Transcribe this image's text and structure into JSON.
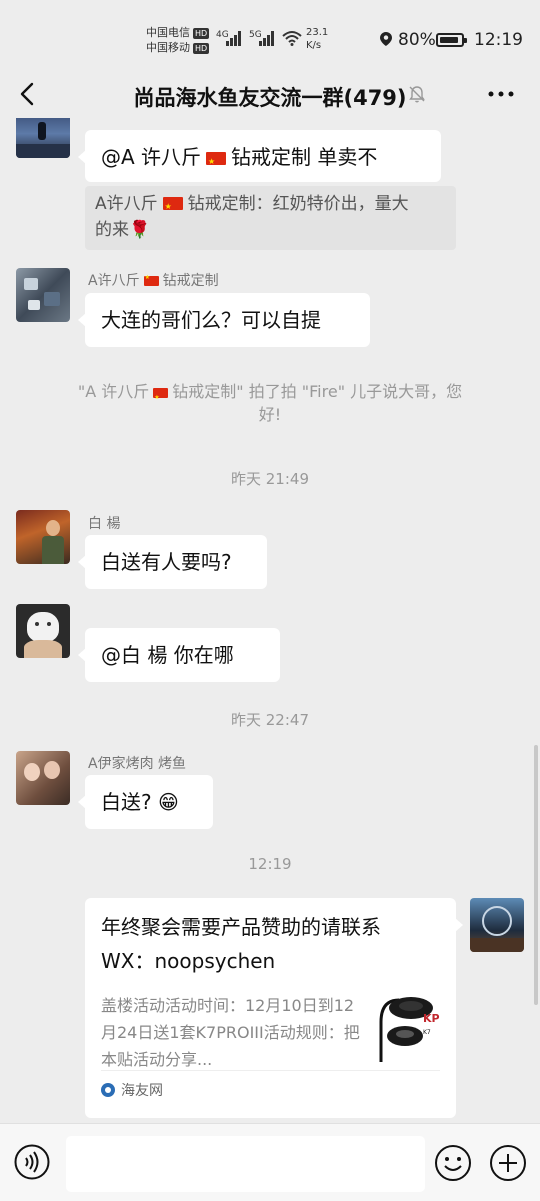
{
  "status_bar": {
    "carrier1": "中国电信",
    "carrier2": "中国移动",
    "hd": "HD",
    "net1": "4G",
    "net2": "5G",
    "speed_value": "23.1",
    "speed_unit": "K/s",
    "battery": "80%",
    "time": "12:19"
  },
  "header": {
    "title": "尚品海水鱼友交流一群(479)",
    "back_icon": "chevron-left-icon",
    "mute_icon": "bell-off-icon",
    "more_icon": "more-icon"
  },
  "messages": {
    "m1_text_a": "@A 许八斤",
    "m1_text_b": "钻戒定制  单卖不",
    "m1_quote_a": "A许八斤",
    "m1_quote_b": "钻戒定制：红奶特价出，量大",
    "m1_quote_c": "的来🌹",
    "m2_sender_a": "A许八斤",
    "m2_sender_b": "钻戒定制",
    "m2_text": "大连的哥们么？可以自提",
    "sys_a": "\"A 许八斤",
    "sys_b": "钻戒定制\" 拍了拍 \"Fire\" 儿子说大哥，您",
    "sys_c": "好!",
    "time1": "昨天 21:49",
    "m3_sender": "白  楊",
    "m3_text": "白送有人要吗?",
    "m4_text": "@白  楊  你在哪",
    "time2": "昨天 22:47",
    "m5_sender": "A伊家烤肉 烤鱼",
    "m5_text": "白送?",
    "m5_emoji": "😁",
    "time3": "12:19"
  },
  "link_card": {
    "title_line1": "年终聚会需要产品赞助的请联系",
    "title_line2": "WX：noopsychen",
    "desc": "盖楼活动活动时间：12月10日到12月24日送1套K7PROIII活动规则：把本贴活动分享...",
    "source": "海友网"
  },
  "input_bar": {
    "voice_icon": "voice-icon",
    "emoji_icon": "emoji-icon",
    "plus_icon": "plus-icon",
    "value": ""
  },
  "colors": {
    "background": "#ededed",
    "bubble": "#ffffff",
    "quote": "#e3e3e3",
    "muted_text": "#999999",
    "flag_red": "#de2910"
  }
}
